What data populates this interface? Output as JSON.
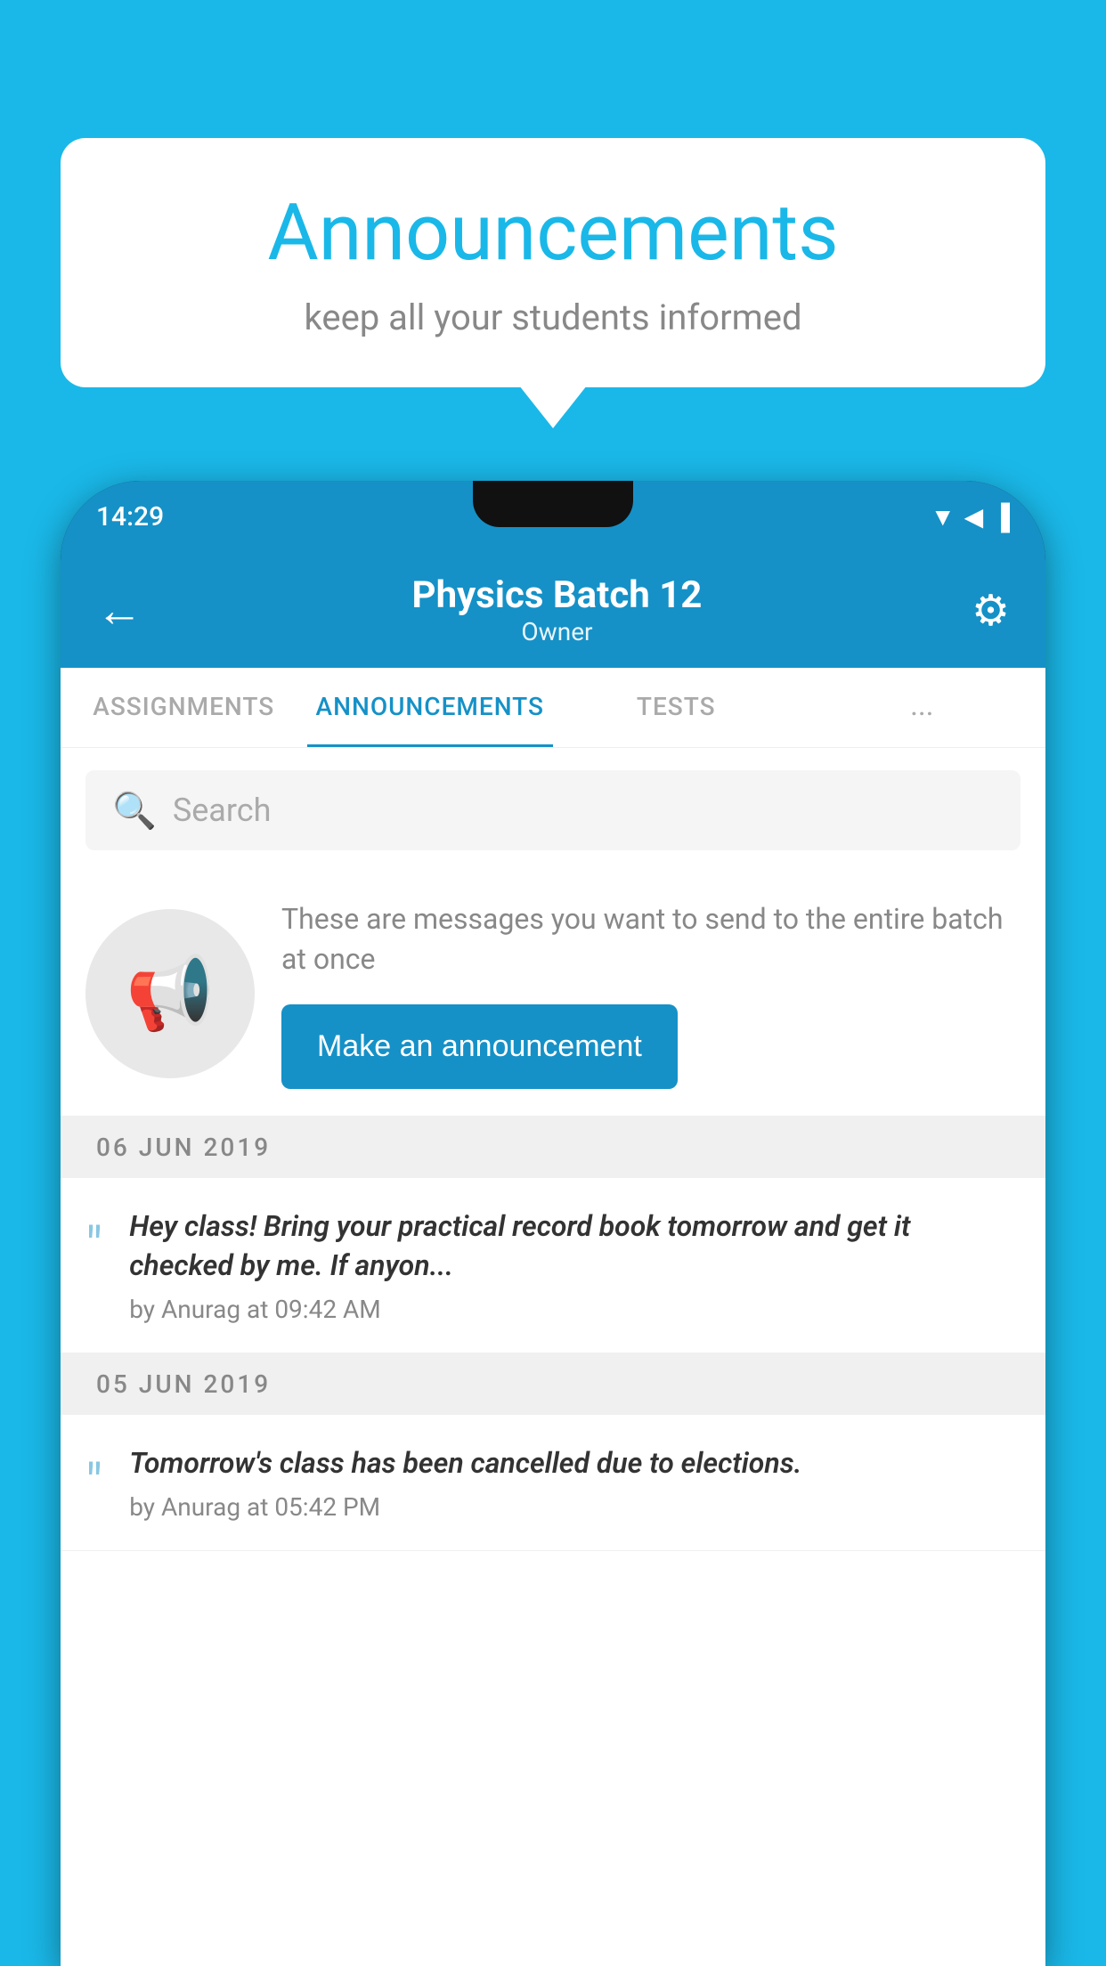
{
  "bubble": {
    "title": "Announcements",
    "subtitle": "keep all your students informed"
  },
  "statusBar": {
    "time": "14:29",
    "icons": "▼◀▐"
  },
  "header": {
    "title": "Physics Batch 12",
    "subtitle": "Owner",
    "backArrow": "←",
    "gearIcon": "⚙"
  },
  "tabs": [
    {
      "label": "ASSIGNMENTS",
      "active": false
    },
    {
      "label": "ANNOUNCEMENTS",
      "active": true
    },
    {
      "label": "TESTS",
      "active": false
    },
    {
      "label": "...",
      "active": false
    }
  ],
  "search": {
    "placeholder": "Search"
  },
  "promo": {
    "text": "These are messages you want to send to the entire batch at once",
    "buttonLabel": "Make an announcement"
  },
  "announcements": [
    {
      "date": "06  JUN  2019",
      "text": "Hey class! Bring your practical record book tomorrow and get it checked by me. If anyon...",
      "meta": "by Anurag at 09:42 AM"
    },
    {
      "date": "05  JUN  2019",
      "text": "Tomorrow's class has been cancelled due to elections.",
      "meta": "by Anurag at 05:42 PM"
    }
  ]
}
